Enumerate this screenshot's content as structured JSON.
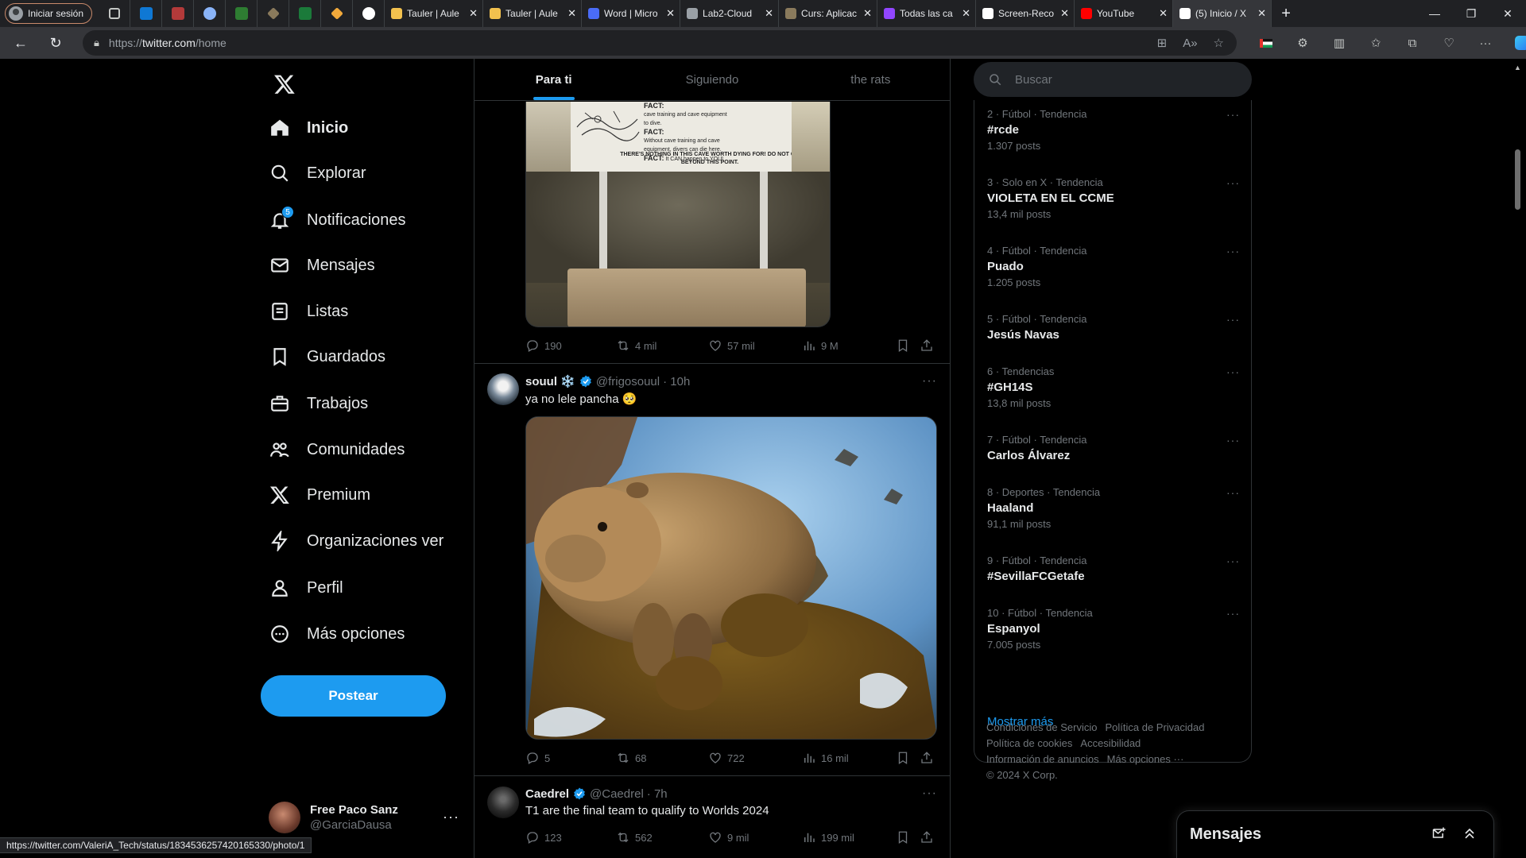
{
  "browser": {
    "profile_label": "Iniciar sesión",
    "tabs": [
      {
        "title": "Tauler | Aule",
        "fav_color": "#f2c14e"
      },
      {
        "title": "Tauler | Aule",
        "fav_color": "#f2c14e"
      },
      {
        "title": "Word | Micro",
        "fav_color": "#4a6cf7"
      },
      {
        "title": "Lab2-Cloud",
        "fav_color": "#9aa0a6"
      },
      {
        "title": "Curs: Aplicac",
        "fav_color": "#8a7a5c"
      },
      {
        "title": "Todas las ca",
        "fav_color": "#9146ff"
      },
      {
        "title": "Screen-Reco",
        "fav_color": "#ffffff"
      },
      {
        "title": "YouTube",
        "fav_color": "#ff0000"
      },
      {
        "title": "(5) Inicio / X",
        "fav_color": "#ffffff"
      }
    ],
    "url_prefix": "https://",
    "url_host": "twitter.com",
    "url_path": "/home",
    "status_url": "https://twitter.com/ValeriA_Tech/status/1834536257420165330/photo/1"
  },
  "nav": {
    "items": [
      {
        "label": "Inicio",
        "icon": "home-icon"
      },
      {
        "label": "Explorar",
        "icon": "search-icon"
      },
      {
        "label": "Notificaciones",
        "icon": "bell-icon"
      },
      {
        "label": "Mensajes",
        "icon": "mail-icon"
      },
      {
        "label": "Listas",
        "icon": "list-icon"
      },
      {
        "label": "Guardados",
        "icon": "bookmark-icon"
      },
      {
        "label": "Trabajos",
        "icon": "briefcase-icon"
      },
      {
        "label": "Comunidades",
        "icon": "people-icon"
      },
      {
        "label": "Premium",
        "icon": "x-logo-icon"
      },
      {
        "label": "Organizaciones ver",
        "icon": "lightning-icon"
      },
      {
        "label": "Perfil",
        "icon": "person-icon"
      },
      {
        "label": "Más opciones",
        "icon": "more-circle-icon"
      }
    ],
    "notif_badge": "5",
    "post_button": "Postear",
    "account_name": "Free Paco Sanz",
    "account_handle": "@GarciaDausa"
  },
  "timeline": {
    "tabs": [
      "Para ti",
      "Siguiendo",
      "the rats"
    ],
    "tweet1_image": {
      "sign_lines": [
        "FACT:",
        "cave training and cave equipment",
        "to dive.",
        "FACT:",
        "Without cave training and cave",
        "equipment, divers can die here.",
        "FACT:",
        "It CAN happen to YOU!"
      ],
      "sign_bottom": "THERE'S NOTHING IN THIS CAVE WORTH DYING FOR! DO NOT GO BEYOND THIS POINT."
    },
    "tweet1_stats": {
      "replies": "190",
      "retweets": "4 mil",
      "likes": "57 mil",
      "views": "9 M"
    },
    "tweet2": {
      "name": "souul ❄️",
      "handle": "@frigosouul",
      "time": "· 10h",
      "text": "ya no lele pancha 🥺",
      "stats": {
        "replies": "5",
        "retweets": "68",
        "likes": "722",
        "views": "16 mil"
      }
    },
    "tweet3": {
      "name": "Caedrel",
      "handle": "@Caedrel",
      "time": "· 7h",
      "text": "T1 are the final team to qualify to Worlds 2024",
      "stats": {
        "replies": "123",
        "retweets": "562",
        "likes": "9 mil",
        "views": "199 mil"
      }
    }
  },
  "sidebar": {
    "search_placeholder": "Buscar",
    "trends": [
      {
        "meta": "2 · Fútbol · Tendencia",
        "name": "#rcde",
        "posts": "1.307 posts"
      },
      {
        "meta": "3 · Solo en X · Tendencia",
        "name": "VIOLETA EN EL CCME",
        "posts": "13,4 mil posts"
      },
      {
        "meta": "4 · Fútbol · Tendencia",
        "name": "Puado",
        "posts": "1.205 posts"
      },
      {
        "meta": "5 · Fútbol · Tendencia",
        "name": "Jesús Navas",
        "posts": ""
      },
      {
        "meta": "6 · Tendencias",
        "name": "#GH14S",
        "posts": "13,8 mil posts"
      },
      {
        "meta": "7 · Fútbol · Tendencia",
        "name": "Carlos Álvarez",
        "posts": ""
      },
      {
        "meta": "8 · Deportes · Tendencia",
        "name": "Haaland",
        "posts": "91,1 mil posts"
      },
      {
        "meta": "9 · Fútbol · Tendencia",
        "name": "#SevillaFCGetafe",
        "posts": ""
      },
      {
        "meta": "10 · Fútbol · Tendencia",
        "name": "Espanyol",
        "posts": "7.005 posts"
      }
    ],
    "show_more": "Mostrar más",
    "footer": [
      "Condiciones de Servicio",
      "Política de Privacidad",
      "Política de cookies",
      "Accesibilidad",
      "Información de anuncios",
      "Más opciones ···",
      "© 2024 X Corp."
    ],
    "messages_title": "Mensajes"
  },
  "colors": {
    "accent": "#1d9bf0",
    "background": "#000000",
    "border": "#2f3336",
    "muted": "#71767b"
  }
}
